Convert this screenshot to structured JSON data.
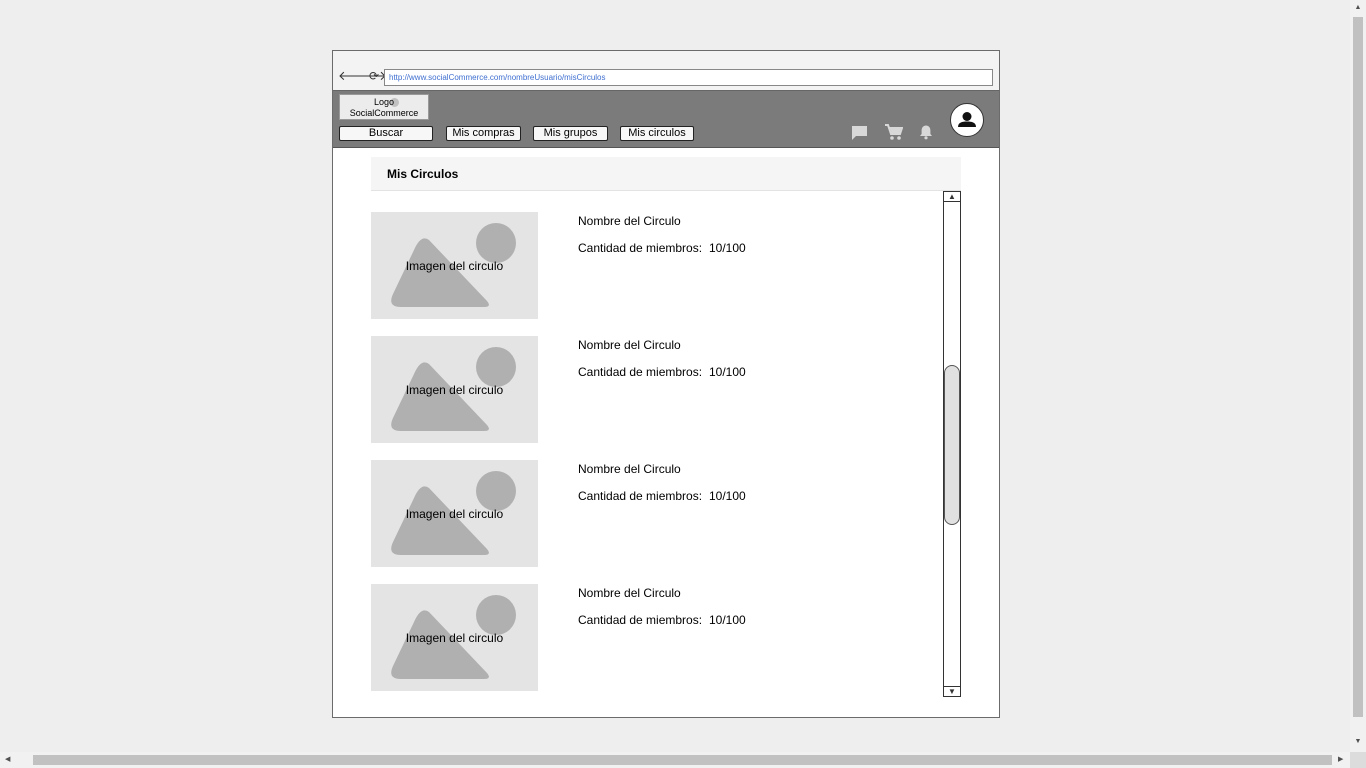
{
  "browser": {
    "back_glyph": "🡐",
    "forward_glyph": "🡒",
    "reload_glyph": "⟳",
    "url": "http://www.socialCommerce.com/nombreUsuario/misCirculos"
  },
  "header": {
    "logo_line1": "Logo",
    "logo_line2": "SocialCommerce",
    "nav": [
      "Buscar",
      "Mis compras",
      "Mis grupos",
      "Mis circulos"
    ],
    "icons": [
      "chat-icon",
      "cart-icon",
      "bell-icon",
      "user-avatar-icon"
    ]
  },
  "panel": {
    "title": "Mis Circulos"
  },
  "circles": [
    {
      "image_label": "Imagen del circulo",
      "name": "Nombre del Circulo",
      "count_label": "Cantidad de miembros:",
      "count_value": "10/100"
    },
    {
      "image_label": "Imagen del circulo",
      "name": "Nombre del Circulo",
      "count_label": "Cantidad de miembros:",
      "count_value": "10/100"
    },
    {
      "image_label": "Imagen del circulo",
      "name": "Nombre del Circulo",
      "count_label": "Cantidad de miembros:",
      "count_value": "10/100"
    },
    {
      "image_label": "Imagen del circulo",
      "name": "Nombre del Circulo",
      "count_label": "Cantidad de miembros:",
      "count_value": "10/100"
    }
  ],
  "colors": {
    "header_bg": "#7b7b7b",
    "placeholder_bg": "#e4e4e4",
    "placeholder_shape": "#b0b0b0",
    "url_text": "#3f6fd0"
  }
}
